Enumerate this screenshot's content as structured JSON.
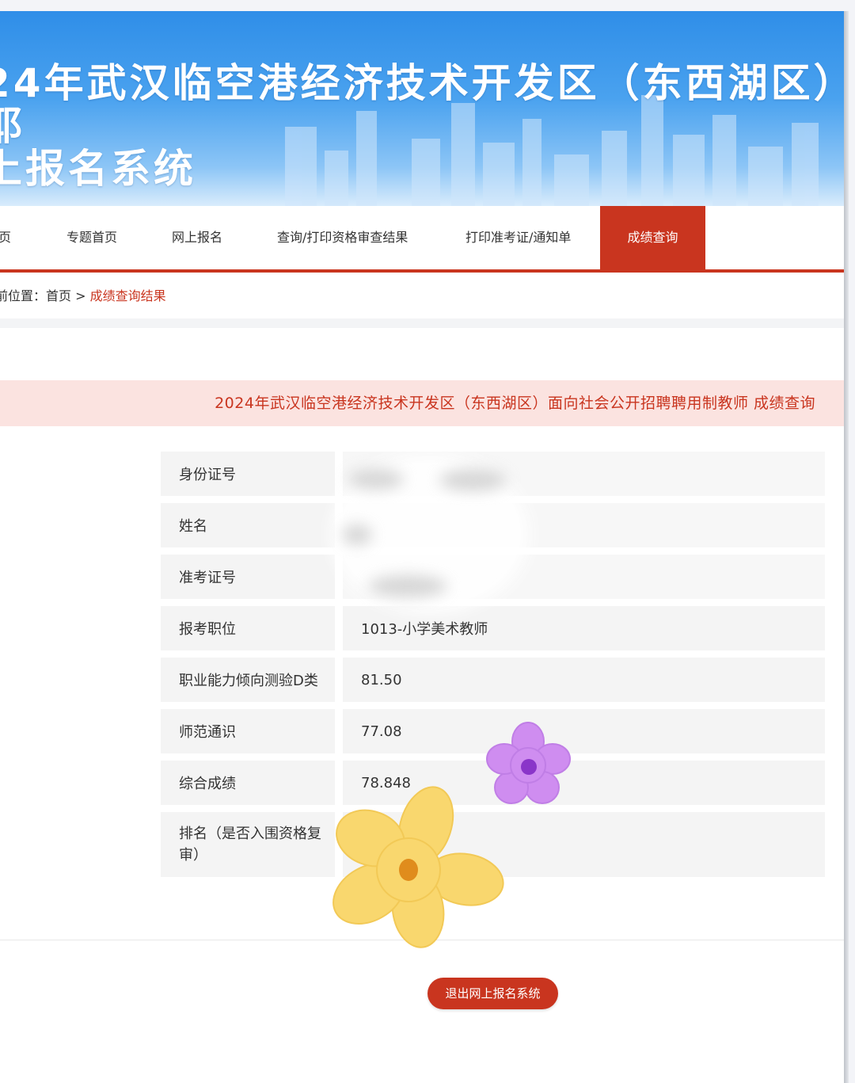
{
  "banner": {
    "title": "24年武汉临空港经济技术开发区（东西湖区）耶\n上报名系统"
  },
  "nav": {
    "items": [
      "页",
      "专题首页",
      "网上报名",
      "查询/打印资格审查结果",
      "打印准考证/通知单"
    ],
    "active": "成绩查询"
  },
  "breadcrumb": {
    "prefix": "前位置：",
    "home": "首页",
    "separator": ">",
    "current": "成绩查询结果"
  },
  "query": {
    "title": "2024年武汉临空港经济技术开发区（东西湖区）面向社会公开招聘聘用制教师 成绩查询"
  },
  "result": {
    "rows": [
      {
        "label": "身份证号",
        "value": ""
      },
      {
        "label": "姓名",
        "value": ""
      },
      {
        "label": "准考证号",
        "value": ""
      },
      {
        "label": "报考职位",
        "value": "1013-小学美术教师"
      },
      {
        "label": "职业能力倾向测验D类",
        "value": "81.50"
      },
      {
        "label": "师范通识",
        "value": "77.08"
      },
      {
        "label": "综合成绩",
        "value": "78.848"
      },
      {
        "label": "排名（是否入围资格复审）",
        "value": ""
      }
    ]
  },
  "actions": {
    "logout_label": "退出网上报名系统"
  },
  "colors": {
    "accent": "#c9351f",
    "banner_blue": "#2f8ee8",
    "query_bar_bg": "#fbe3e0",
    "cell_bg": "#f4f4f4",
    "sticker_purple": "#cf8df0",
    "sticker_yellow": "#f9d76e"
  }
}
